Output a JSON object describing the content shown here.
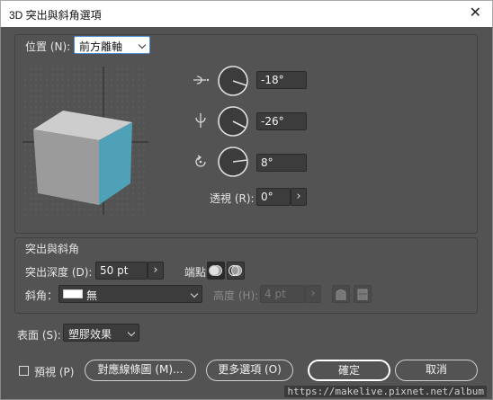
{
  "window": {
    "title": "3D 突出與斜角選項",
    "close_glyph": "✕"
  },
  "position": {
    "label": "位置 (N):",
    "preset": "前方離軸",
    "x_angle": "-18°",
    "y_angle": "-26°",
    "z_angle": "8°",
    "perspective_label": "透視 (R):",
    "perspective_value": "0°",
    "step_glyph": "›"
  },
  "extrude": {
    "section_label": "突出與斜角",
    "depth_label": "突出深度 (D):",
    "depth_value": "50 pt",
    "cap_label": "端點：",
    "bevel_label": "斜角：",
    "bevel_value": "無",
    "height_label": "高度 (H):",
    "height_value": "4 pt"
  },
  "surface": {
    "label": "表面 (S):",
    "value": "塑膠效果"
  },
  "buttons": {
    "preview_label": "預視 (P)",
    "map_art": "對應線條圖 (M)...",
    "more_options": "更多選項 (O)",
    "ok": "確定",
    "cancel": "取消"
  },
  "watermark": "https://makelive.pixnet.net/album",
  "colors": {
    "dialog_bg": "#535353",
    "cube_front": "#4ea1b6",
    "cube_top": "#c9c9c9",
    "cube_side": "#9a9a9a",
    "focus_blue": "#4a90d9"
  }
}
